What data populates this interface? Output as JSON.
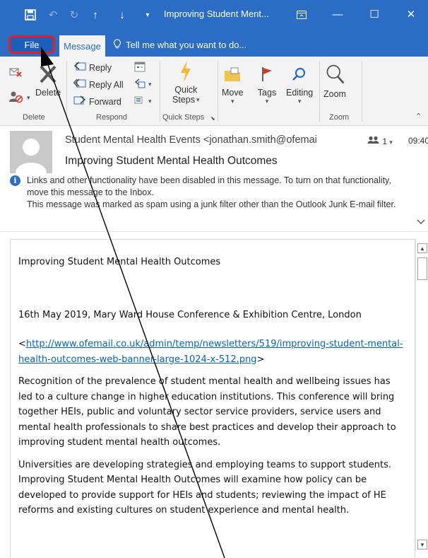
{
  "window": {
    "title": "Improving Student Ment...",
    "minimize_glyph": "—",
    "maximize_glyph": "☐",
    "close_glyph": "✕"
  },
  "tabs": {
    "file": "File",
    "message": "Message",
    "tell_me": "Tell me what you want to do..."
  },
  "ribbon": {
    "groups": {
      "delete": "Delete",
      "respond": "Respond",
      "quick_steps": "Quick Steps",
      "zoom": "Zoom"
    },
    "buttons": {
      "delete": "Delete",
      "reply": "Reply",
      "reply_all": "Reply All",
      "forward": "Forward",
      "quick_steps_line1": "Quick",
      "quick_steps_line2": "Steps",
      "move": "Move",
      "tags": "Tags",
      "editing": "Editing",
      "zoom": "Zoom"
    }
  },
  "header": {
    "sender": "Student Mental Health Events <jonathan.smith@ofemai",
    "people_count": "1",
    "time": "09:40",
    "subject": "Improving Student Mental Health Outcomes",
    "info_line1": "Links and other functionality have been disabled in this message. To turn on that functionality, move this message to the Inbox.",
    "info_line2": "This message was marked as spam using a junk filter other than the Outlook Junk E-mail filter."
  },
  "body": {
    "heading": "Improving Student Mental Health Outcomes",
    "date_venue": "16th May 2019, Mary Ward House Conference & Exhibition Centre, London",
    "link_prefix": "<",
    "link": "http://www.ofemail.co.uk/admin/temp/newsletters/519/improving-student-mental-health-outcomes-web-banner-large-1024-x-512.png",
    "link_suffix": ">",
    "para1": "Recognition of the prevalence of student mental health and wellbeing issues has led to a culture change in higher education institutions. This conference will bring together HEIs, public and voluntary sector service providers, service users and mental health professionals to share best practices and develop their approach to improving student mental health outcomes.",
    "para2": "Universities are developing strategies and employing teams to support students. Improving Student Mental Health Outcomes will examine how policy can be developed to provide support for HEIs and students; reviewing the impact of HE reforms and existing cultures on student experience and mental health."
  },
  "colors": {
    "accent": "#2b6cc4",
    "highlight": "#e2202a",
    "link": "#0563c1"
  }
}
